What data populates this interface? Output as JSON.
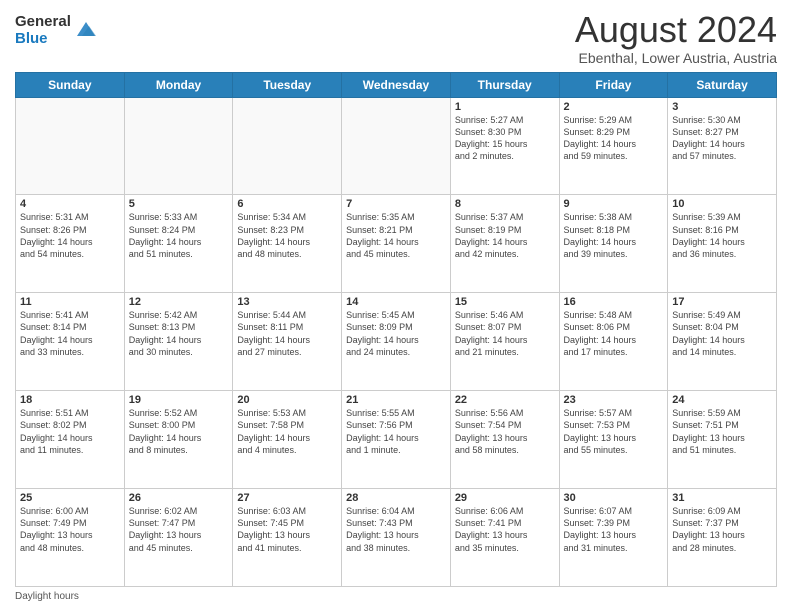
{
  "logo": {
    "general": "General",
    "blue": "Blue"
  },
  "header": {
    "month": "August 2024",
    "location": "Ebenthal, Lower Austria, Austria"
  },
  "weekdays": [
    "Sunday",
    "Monday",
    "Tuesday",
    "Wednesday",
    "Thursday",
    "Friday",
    "Saturday"
  ],
  "footer": {
    "daylight_label": "Daylight hours"
  },
  "weeks": [
    [
      {
        "day": "",
        "info": ""
      },
      {
        "day": "",
        "info": ""
      },
      {
        "day": "",
        "info": ""
      },
      {
        "day": "",
        "info": ""
      },
      {
        "day": "1",
        "info": "Sunrise: 5:27 AM\nSunset: 8:30 PM\nDaylight: 15 hours\nand 2 minutes."
      },
      {
        "day": "2",
        "info": "Sunrise: 5:29 AM\nSunset: 8:29 PM\nDaylight: 14 hours\nand 59 minutes."
      },
      {
        "day": "3",
        "info": "Sunrise: 5:30 AM\nSunset: 8:27 PM\nDaylight: 14 hours\nand 57 minutes."
      }
    ],
    [
      {
        "day": "4",
        "info": "Sunrise: 5:31 AM\nSunset: 8:26 PM\nDaylight: 14 hours\nand 54 minutes."
      },
      {
        "day": "5",
        "info": "Sunrise: 5:33 AM\nSunset: 8:24 PM\nDaylight: 14 hours\nand 51 minutes."
      },
      {
        "day": "6",
        "info": "Sunrise: 5:34 AM\nSunset: 8:23 PM\nDaylight: 14 hours\nand 48 minutes."
      },
      {
        "day": "7",
        "info": "Sunrise: 5:35 AM\nSunset: 8:21 PM\nDaylight: 14 hours\nand 45 minutes."
      },
      {
        "day": "8",
        "info": "Sunrise: 5:37 AM\nSunset: 8:19 PM\nDaylight: 14 hours\nand 42 minutes."
      },
      {
        "day": "9",
        "info": "Sunrise: 5:38 AM\nSunset: 8:18 PM\nDaylight: 14 hours\nand 39 minutes."
      },
      {
        "day": "10",
        "info": "Sunrise: 5:39 AM\nSunset: 8:16 PM\nDaylight: 14 hours\nand 36 minutes."
      }
    ],
    [
      {
        "day": "11",
        "info": "Sunrise: 5:41 AM\nSunset: 8:14 PM\nDaylight: 14 hours\nand 33 minutes."
      },
      {
        "day": "12",
        "info": "Sunrise: 5:42 AM\nSunset: 8:13 PM\nDaylight: 14 hours\nand 30 minutes."
      },
      {
        "day": "13",
        "info": "Sunrise: 5:44 AM\nSunset: 8:11 PM\nDaylight: 14 hours\nand 27 minutes."
      },
      {
        "day": "14",
        "info": "Sunrise: 5:45 AM\nSunset: 8:09 PM\nDaylight: 14 hours\nand 24 minutes."
      },
      {
        "day": "15",
        "info": "Sunrise: 5:46 AM\nSunset: 8:07 PM\nDaylight: 14 hours\nand 21 minutes."
      },
      {
        "day": "16",
        "info": "Sunrise: 5:48 AM\nSunset: 8:06 PM\nDaylight: 14 hours\nand 17 minutes."
      },
      {
        "day": "17",
        "info": "Sunrise: 5:49 AM\nSunset: 8:04 PM\nDaylight: 14 hours\nand 14 minutes."
      }
    ],
    [
      {
        "day": "18",
        "info": "Sunrise: 5:51 AM\nSunset: 8:02 PM\nDaylight: 14 hours\nand 11 minutes."
      },
      {
        "day": "19",
        "info": "Sunrise: 5:52 AM\nSunset: 8:00 PM\nDaylight: 14 hours\nand 8 minutes."
      },
      {
        "day": "20",
        "info": "Sunrise: 5:53 AM\nSunset: 7:58 PM\nDaylight: 14 hours\nand 4 minutes."
      },
      {
        "day": "21",
        "info": "Sunrise: 5:55 AM\nSunset: 7:56 PM\nDaylight: 14 hours\nand 1 minute."
      },
      {
        "day": "22",
        "info": "Sunrise: 5:56 AM\nSunset: 7:54 PM\nDaylight: 13 hours\nand 58 minutes."
      },
      {
        "day": "23",
        "info": "Sunrise: 5:57 AM\nSunset: 7:53 PM\nDaylight: 13 hours\nand 55 minutes."
      },
      {
        "day": "24",
        "info": "Sunrise: 5:59 AM\nSunset: 7:51 PM\nDaylight: 13 hours\nand 51 minutes."
      }
    ],
    [
      {
        "day": "25",
        "info": "Sunrise: 6:00 AM\nSunset: 7:49 PM\nDaylight: 13 hours\nand 48 minutes."
      },
      {
        "day": "26",
        "info": "Sunrise: 6:02 AM\nSunset: 7:47 PM\nDaylight: 13 hours\nand 45 minutes."
      },
      {
        "day": "27",
        "info": "Sunrise: 6:03 AM\nSunset: 7:45 PM\nDaylight: 13 hours\nand 41 minutes."
      },
      {
        "day": "28",
        "info": "Sunrise: 6:04 AM\nSunset: 7:43 PM\nDaylight: 13 hours\nand 38 minutes."
      },
      {
        "day": "29",
        "info": "Sunrise: 6:06 AM\nSunset: 7:41 PM\nDaylight: 13 hours\nand 35 minutes."
      },
      {
        "day": "30",
        "info": "Sunrise: 6:07 AM\nSunset: 7:39 PM\nDaylight: 13 hours\nand 31 minutes."
      },
      {
        "day": "31",
        "info": "Sunrise: 6:09 AM\nSunset: 7:37 PM\nDaylight: 13 hours\nand 28 minutes."
      }
    ]
  ]
}
